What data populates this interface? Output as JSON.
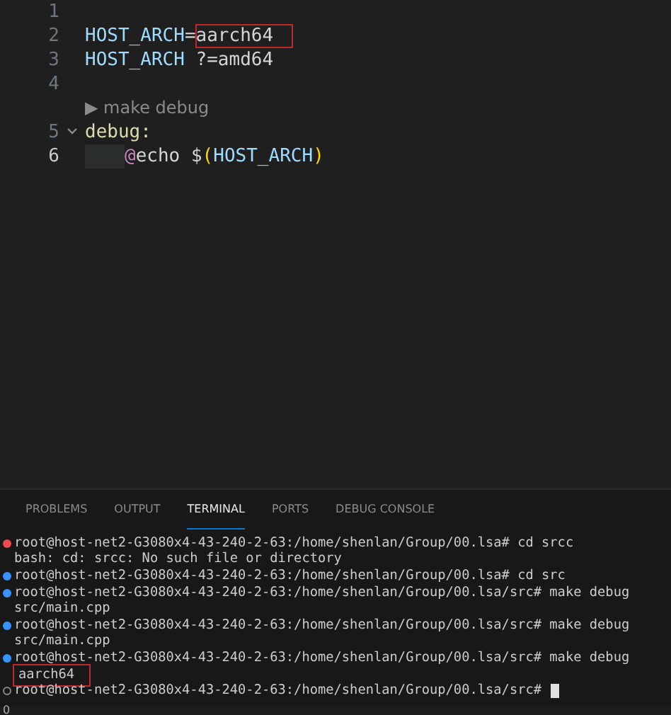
{
  "editor": {
    "lines": [
      {
        "number": "1",
        "current": false
      },
      {
        "number": "2",
        "current": false,
        "tokens": [
          {
            "text": "HOST_ARCH",
            "kind": "variable",
            "highlight": false
          },
          {
            "text": "=",
            "kind": "operator",
            "highlight": false
          },
          {
            "text": "aarch64",
            "kind": "value",
            "highlight": true
          }
        ]
      },
      {
        "number": "3",
        "current": false,
        "tokens": [
          {
            "text": "HOST_ARCH ",
            "kind": "variable",
            "highlight": false
          },
          {
            "text": "?=amd64",
            "kind": "operator",
            "highlight": false
          }
        ]
      },
      {
        "number": "4",
        "current": false
      },
      {
        "kind": "codelens",
        "text": "▶ make debug"
      },
      {
        "number": "5",
        "current": false,
        "foldable": true,
        "tokens": [
          {
            "text": "debug:",
            "kind": "target",
            "highlight": false
          }
        ]
      },
      {
        "number": "6",
        "current": true,
        "indent": true,
        "tokens": [
          {
            "text": "@",
            "kind": "operator",
            "highlight": false
          },
          {
            "text": "echo ",
            "kind": "value",
            "highlight": false
          },
          {
            "text": "$",
            "kind": "operator",
            "highlight": false
          },
          {
            "text": "(",
            "kind": "paren",
            "highlight": false
          },
          {
            "text": "HOST_ARCH",
            "kind": "variable",
            "highlight": false
          },
          {
            "text": ")",
            "kind": "paren",
            "highlight": false
          }
        ]
      }
    ]
  },
  "panel": {
    "tabs": [
      {
        "label": "PROBLEMS",
        "selected": false
      },
      {
        "label": "OUTPUT",
        "selected": false
      },
      {
        "label": "TERMINAL",
        "selected": true
      },
      {
        "label": "PORTS",
        "selected": false
      },
      {
        "label": "DEBUG CONSOLE",
        "selected": false
      }
    ],
    "terminal": [
      {
        "kind": "error",
        "text": "root@host-net2-G3080x4-43-240-2-63:/home/shenlan/Group/00.lsa# cd srcc",
        "highlight": false
      },
      {
        "kind": "output",
        "text": "bash: cd: srcc: No such file or directory",
        "highlight": false
      },
      {
        "kind": "success",
        "text": "root@host-net2-G3080x4-43-240-2-63:/home/shenlan/Group/00.lsa# cd src",
        "highlight": false
      },
      {
        "kind": "success",
        "text": "root@host-net2-G3080x4-43-240-2-63:/home/shenlan/Group/00.lsa/src# make debug",
        "highlight": false
      },
      {
        "kind": "output",
        "text": "src/main.cpp",
        "highlight": false
      },
      {
        "kind": "success",
        "text": "root@host-net2-G3080x4-43-240-2-63:/home/shenlan/Group/00.lsa/src# make debug",
        "highlight": false
      },
      {
        "kind": "output",
        "text": "src/main.cpp",
        "highlight": false
      },
      {
        "kind": "success",
        "text": "root@host-net2-G3080x4-43-240-2-63:/home/shenlan/Group/00.lsa/src# make debug",
        "highlight": false
      },
      {
        "kind": "output",
        "text": "aarch64",
        "highlight": true
      },
      {
        "kind": "pending",
        "text": "root@host-net2-G3080x4-43-240-2-63:/home/shenlan/Group/00.lsa/src# ",
        "highlight": false,
        "cursor": true
      }
    ]
  },
  "status_bar": {
    "text": "0"
  }
}
